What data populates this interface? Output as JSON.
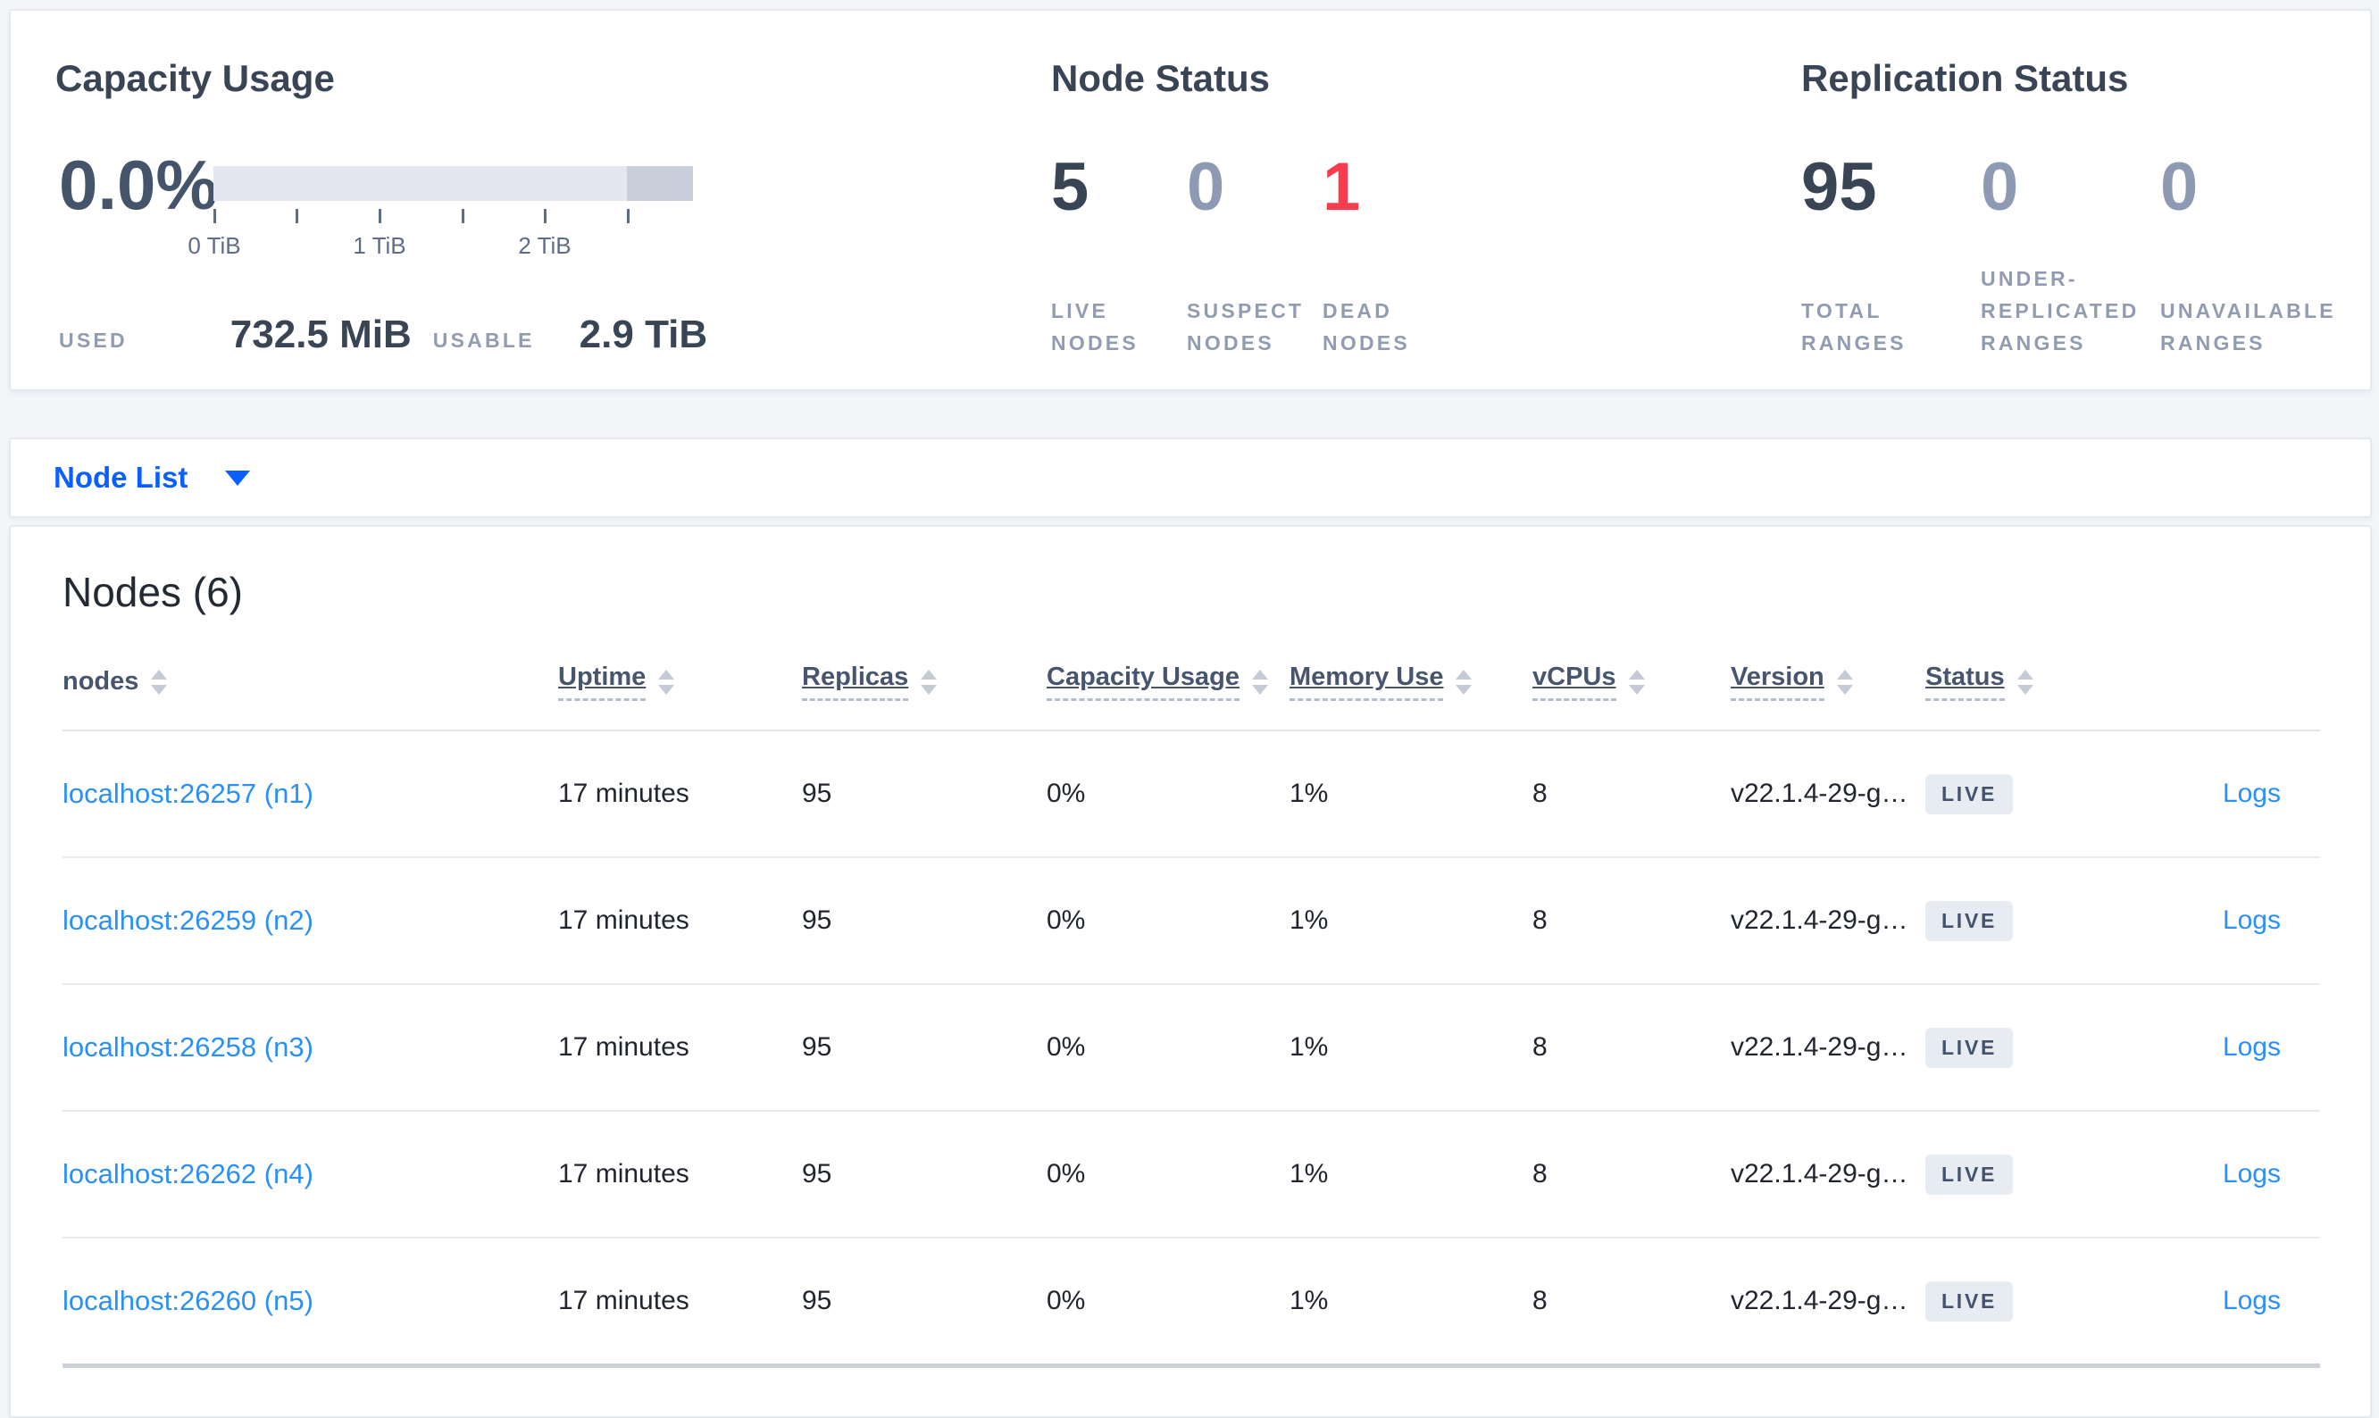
{
  "colors": {
    "accent_blue": "#0b5fff",
    "link_blue": "#2b90f5",
    "danger_red": "#fb3b4e",
    "heading_navy": "#394455",
    "muted_number": "#8e99b3",
    "badge_bg": "#e7ebf2",
    "capacity_bar_light": "#e4e7ef",
    "capacity_bar_dark": "#c9cfda"
  },
  "capacity_usage": {
    "title": "Capacity Usage",
    "percent": "0.0%",
    "axis_ticks": [
      "0 TiB",
      "1 TiB",
      "2 TiB"
    ],
    "used_label": "USED",
    "used_value": "732.5 MiB",
    "usable_label": "USABLE",
    "usable_value": "2.9 TiB"
  },
  "node_status": {
    "title": "Node Status",
    "metrics": [
      {
        "value": "5",
        "label": "LIVE NODES"
      },
      {
        "value": "0",
        "label": "SUSPECT NODES"
      },
      {
        "value": "1",
        "label": "DEAD NODES"
      }
    ]
  },
  "replication_status": {
    "title": "Replication Status",
    "metrics": [
      {
        "value": "95",
        "label": "TOTAL RANGES"
      },
      {
        "value": "0",
        "label": "UNDER-REPLICATED RANGES"
      },
      {
        "value": "0",
        "label": "UNAVAILABLE RANGES"
      }
    ]
  },
  "node_list": {
    "label": "Node List"
  },
  "nodes_table": {
    "title": "Nodes (6)",
    "columns": [
      "nodes",
      "Uptime",
      "Replicas",
      "Capacity Usage",
      "Memory Use",
      "vCPUs",
      "Version",
      "Status"
    ],
    "rows": [
      {
        "node": "localhost:26257 (n1)",
        "uptime": "17 minutes",
        "replicas": "95",
        "capacity_usage": "0%",
        "memory_use": "1%",
        "vcpus": "8",
        "version": "v22.1.4-29-g…",
        "status": "LIVE",
        "logs": "Logs"
      },
      {
        "node": "localhost:26259 (n2)",
        "uptime": "17 minutes",
        "replicas": "95",
        "capacity_usage": "0%",
        "memory_use": "1%",
        "vcpus": "8",
        "version": "v22.1.4-29-g…",
        "status": "LIVE",
        "logs": "Logs"
      },
      {
        "node": "localhost:26258 (n3)",
        "uptime": "17 minutes",
        "replicas": "95",
        "capacity_usage": "0%",
        "memory_use": "1%",
        "vcpus": "8",
        "version": "v22.1.4-29-g…",
        "status": "LIVE",
        "logs": "Logs"
      },
      {
        "node": "localhost:26262 (n4)",
        "uptime": "17 minutes",
        "replicas": "95",
        "capacity_usage": "0%",
        "memory_use": "1%",
        "vcpus": "8",
        "version": "v22.1.4-29-g…",
        "status": "LIVE",
        "logs": "Logs"
      },
      {
        "node": "localhost:26260 (n5)",
        "uptime": "17 minutes",
        "replicas": "95",
        "capacity_usage": "0%",
        "memory_use": "1%",
        "vcpus": "8",
        "version": "v22.1.4-29-g…",
        "status": "LIVE",
        "logs": "Logs"
      }
    ]
  }
}
